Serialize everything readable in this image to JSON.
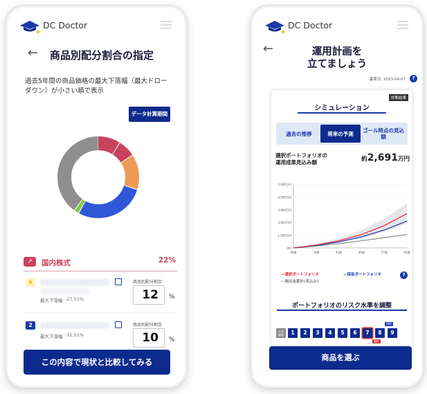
{
  "left_screen": {
    "brand": "DC Doctor",
    "title": "商品別配分割合の指定",
    "description": "過去5年間の商品価格の最大下落幅（最大ドローダウン）が小さい順で表示",
    "data_period_button": "データ計算期間",
    "donut_slices": [
      {
        "color": "#c8435e",
        "value": 9
      },
      {
        "color": "#c8435e",
        "value": 7
      },
      {
        "color": "#ee9a55",
        "value": 14
      },
      {
        "color": "#2f58d8",
        "value": 28
      },
      {
        "color": "#8ac84a",
        "value": 2
      },
      {
        "color": "#8f8f8f",
        "value": 40
      }
    ],
    "category": {
      "name": "国内株式",
      "percent": "22%"
    },
    "funds": [
      {
        "rank": "crown",
        "drop_label": "最大下落幅",
        "drop_value": "-27.51%",
        "alloc_label": "商品別配分割合",
        "alloc_value": "12",
        "unit": "%"
      },
      {
        "rank": "2",
        "drop_label": "最大下落幅",
        "drop_value": "-31.01%",
        "alloc_label": "商品別配分割合",
        "alloc_value": "10",
        "unit": "%"
      }
    ],
    "compare_button": "この内容で現状と比較してみる"
  },
  "right_screen": {
    "brand": "DC Doctor",
    "title_line1": "運用計画を",
    "title_line2": "立てましょう",
    "base_date": "基準日: 2023-04-07",
    "diagnosis_badge": "診断結果",
    "simulation_title": "シミュレーション",
    "tabs": [
      "過去の推移",
      "将来の予測",
      "ゴール時点の見込額"
    ],
    "active_tab": 1,
    "portfolio_label_1": "選択ポートフォリオの",
    "portfolio_label_2": "運用成果見込み額",
    "amount_prefix": "約",
    "amount": "2,691",
    "amount_unit": "万円",
    "chart_data": {
      "type": "line",
      "x": [
        "28歳",
        "34歳",
        "41歳",
        "49歳",
        "57歳",
        "65歳"
      ],
      "y_ticks": [
        "0円",
        "1,000万円",
        "2,000万円",
        "3,000万円",
        "4,000万円",
        "5,000万円"
      ],
      "ylim": [
        0,
        5000
      ],
      "series": [
        {
          "name": "選択ポートフォリオ",
          "color": "#e0243a",
          "values": [
            0,
            220,
            560,
            1050,
            1750,
            2691
          ]
        },
        {
          "name": "保有ポートフォリオ",
          "color": "#1b3aa8",
          "values": [
            0,
            190,
            470,
            870,
            1400,
            2100
          ]
        },
        {
          "name": "拠出金累計(見込み)",
          "color": "#888888",
          "values": [
            0,
            150,
            330,
            560,
            800,
            1050
          ]
        }
      ],
      "band": {
        "upper": [
          0,
          300,
          760,
          1400,
          2300,
          3500
        ],
        "lower": [
          0,
          180,
          430,
          780,
          1250,
          1900
        ]
      }
    },
    "legend": [
      "選択ポートフォリオ",
      "保有ポートフォリオ",
      "拠出金累計(見込み)"
    ],
    "risk_title": "ポートフォリオのリスク水準を調整",
    "principal_label_1": "元本",
    "principal_label_2": "確保",
    "risk_levels": [
      "1",
      "2",
      "3",
      "4",
      "5",
      "6",
      "7",
      "8",
      "9"
    ],
    "current_tag": "現状",
    "selected_tag": "選択",
    "choose_button": "商品を選ぶ"
  }
}
